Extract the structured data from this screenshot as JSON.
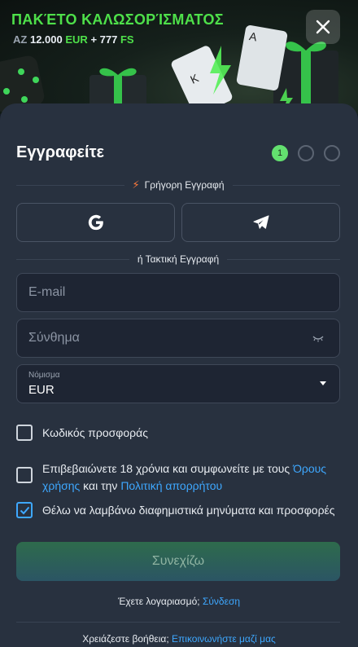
{
  "banner": {
    "title": "ΠΑΚΈΤΟ ΚΑΛΩΣΟΡΊΣΜΑΤΟΣ",
    "prefix": "ΑΖ",
    "amount": "12.000",
    "currency": "EUR",
    "plus_amount": "+ 777",
    "fs": "FS",
    "accent_color": "#4ee04a"
  },
  "close_icon": "close-icon",
  "form": {
    "title": "Εγγραφείτε",
    "steps": [
      "1",
      "",
      ""
    ],
    "quick_label": "Γρήγορη Εγγραφή",
    "classic_label": "ή Τακτική Εγγραφή",
    "social": [
      {
        "name": "google",
        "icon": "google-icon"
      },
      {
        "name": "telegram",
        "icon": "telegram-icon"
      }
    ],
    "email_placeholder": "E-mail",
    "password_placeholder": "Σύνθημα",
    "currency_label": "Νόμισμα",
    "currency_value": "EUR",
    "promo_label": "Κωδικός προσφοράς",
    "terms_text_1": "Επιβεβαιώνετε 18 χρόνια και συμφωνείτε με τους",
    "terms_link": "Όρους χρήσης",
    "terms_and": "και την",
    "privacy_link": "Πολιτική απορρήτου",
    "marketing_label": "Θέλω να λαμβάνω διαφημιστικά μηνύματα και προσφορές",
    "marketing_checked": true,
    "continue_label": "Συνεχίζω",
    "have_account": "Έχετε λογαριασμό;",
    "login_link": "Σύνδεση",
    "need_help": "Χρειάζεστε βοήθεια;",
    "contact_link": "Επικοινωνήστε μαζί μας",
    "link_color": "#3ea8ff"
  }
}
